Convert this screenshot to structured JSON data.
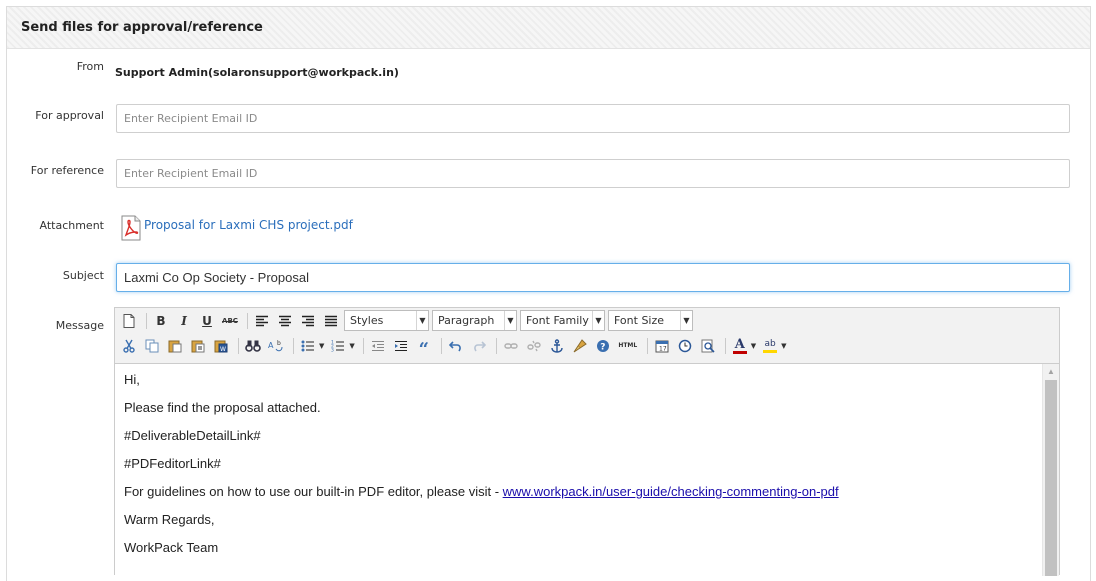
{
  "panel": {
    "title": "Send files for approval/reference"
  },
  "from": {
    "label": "From",
    "value": "Support Admin(solaronsupport@workpack.in)"
  },
  "for_approval": {
    "label": "For approval",
    "placeholder": "Enter Recipient Email ID",
    "value": ""
  },
  "for_reference": {
    "label": "For reference",
    "placeholder": "Enter Recipient Email ID",
    "value": ""
  },
  "attachment": {
    "label": "Attachment",
    "filename": "Proposal for Laxmi CHS project.pdf",
    "icon": "pdf-file-icon"
  },
  "subject": {
    "label": "Subject",
    "value": "Laxmi Co Op Society - Proposal"
  },
  "message": {
    "label": "Message",
    "toolbar": {
      "row1": [
        "new-document-icon",
        "bold-icon",
        "italic-icon",
        "underline-icon",
        "strikethrough-icon",
        "align-left-icon",
        "align-center-icon",
        "align-right-icon",
        "align-justify-icon"
      ],
      "selects": {
        "styles": "Styles",
        "paragraph": "Paragraph",
        "font_family": "Font Family",
        "font_size": "Font Size"
      },
      "row2": [
        "cut-icon",
        "copy-icon",
        "paste-icon",
        "paste-text-icon",
        "paste-word-icon",
        "find-icon",
        "replace-icon",
        "bullet-list-icon",
        "numbered-list-icon",
        "outdent-icon",
        "indent-icon",
        "blockquote-icon",
        "undo-icon",
        "redo-icon",
        "link-icon",
        "unlink-icon",
        "anchor-icon",
        "cleanup-icon",
        "help-icon",
        "html-source-icon",
        "insert-date-icon",
        "insert-time-icon",
        "preview-icon",
        "text-color-icon",
        "highlight-color-icon"
      ],
      "bold": "B",
      "italic": "I",
      "underline": "U",
      "strike": "ABC",
      "html": "HTML",
      "quote": "“",
      "font_color_glyph": "A",
      "highlight_glyph": "ab"
    },
    "body": {
      "greeting": "Hi,",
      "line1": "Please find the proposal attached.",
      "line2": "#DeliverableDetailLink#",
      "line3": "#PDFeditorLink#",
      "line4_prefix": "For guidelines on how to use our built-in PDF editor, please visit - ",
      "line4_link": "www.workpack.in/user-guide/checking-commenting-on-pdf",
      "closing": "Warm Regards,",
      "signature": "WorkPack Team"
    }
  },
  "colors": {
    "link": "#2a6ebb",
    "body_link": "#1a0dab",
    "focus": "#66afe9",
    "pdf_red": "#d9302c",
    "font_color_bar": "#c00000",
    "highlight_bar": "#ffd700"
  }
}
